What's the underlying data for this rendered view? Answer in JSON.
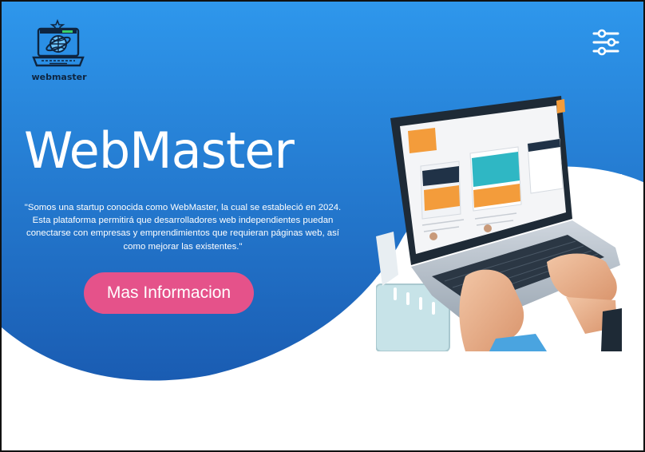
{
  "brand": {
    "logo_text": "webmaster"
  },
  "hero": {
    "title": "WebMaster",
    "description": "\"Somos una startup conocida como WebMaster, la cual se estableció en 2024. Esta plataforma permitirá que desarrolladores web independientes puedan conectarse con empresas y emprendimientos que requieran páginas web, así como mejorar las existentes.\"",
    "cta_label": "Mas Informacion"
  },
  "icons": {
    "logo": "laptop-globe-icon",
    "menu": "sliders-menu-icon"
  },
  "colors": {
    "blue_top": "#2c95ea",
    "blue_bottom": "#1b5fb4",
    "cta": "#e5528a",
    "logo_dark": "#0e2540",
    "white": "#ffffff"
  }
}
